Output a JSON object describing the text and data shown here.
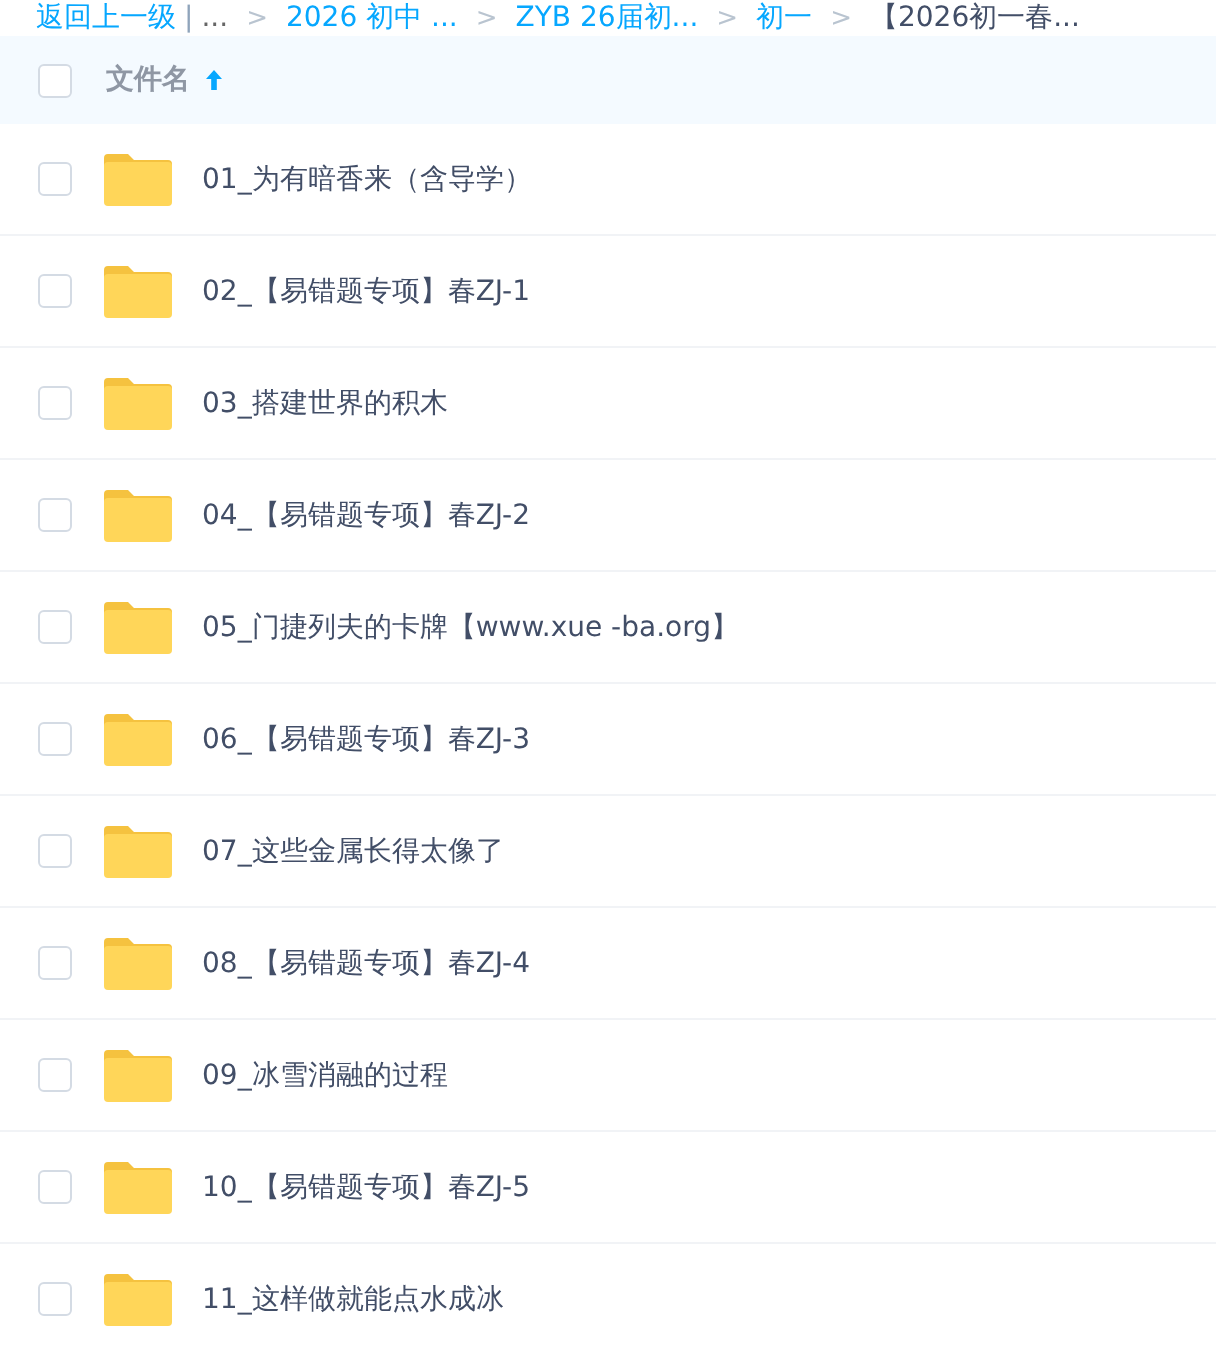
{
  "breadcrumb": {
    "back": "返回上一级",
    "divider": "|",
    "crumbs": [
      {
        "label": "...",
        "kind": "more"
      },
      {
        "label": "2026 初中 ...",
        "kind": "link",
        "sep": ">"
      },
      {
        "label": "ZYB 26届初...",
        "kind": "link",
        "sep": ">"
      },
      {
        "label": "初一",
        "kind": "link",
        "sep": ">"
      },
      {
        "label": "【2026初一春...",
        "kind": "current",
        "sep": ">"
      }
    ]
  },
  "header": {
    "checked": false,
    "column": "文件名",
    "sort_ascending": true
  },
  "files": [
    {
      "name": "01_为有暗香来（含导学）",
      "checked": false
    },
    {
      "name": "02_【易错题专项】春ZJ-1",
      "checked": false
    },
    {
      "name": "03_搭建世界的积木",
      "checked": false
    },
    {
      "name": "04_【易错题专项】春ZJ-2",
      "checked": false
    },
    {
      "name": "05_门捷列夫的卡牌【www.xue -ba.org】",
      "checked": false
    },
    {
      "name": "06_【易错题专项】春ZJ-3",
      "checked": false
    },
    {
      "name": "07_这些金属长得太像了",
      "checked": false
    },
    {
      "name": "08_【易错题专项】春ZJ-4",
      "checked": false
    },
    {
      "name": "09_冰雪消融的过程",
      "checked": false
    },
    {
      "name": "10_【易错题专项】春ZJ-5",
      "checked": false
    },
    {
      "name": "11_这样做就能点水成冰",
      "checked": false
    }
  ]
}
